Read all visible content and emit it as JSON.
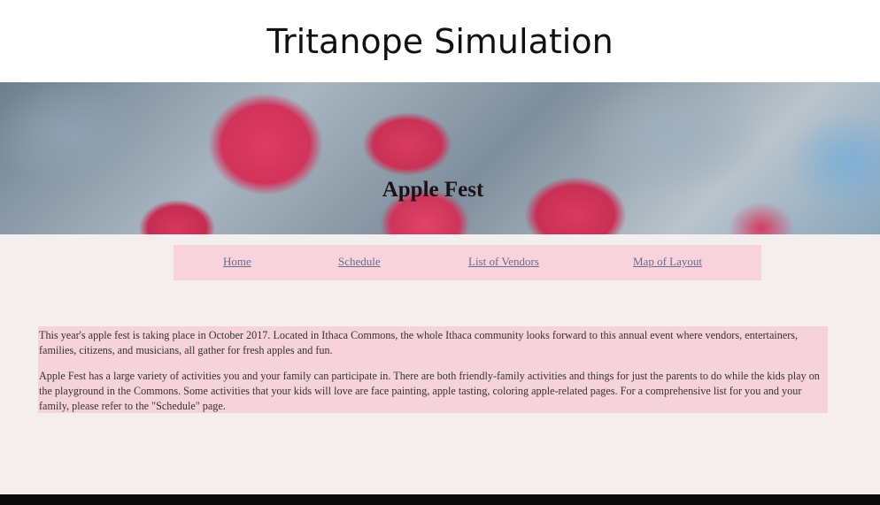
{
  "caption": "Tritanope Simulation",
  "page": {
    "title": "Apple Fest",
    "nav": [
      {
        "label": "Home"
      },
      {
        "label": "Schedule"
      },
      {
        "label": "List of Vendors"
      },
      {
        "label": "Map of Layout"
      }
    ],
    "paragraphs": [
      "This year's apple fest is taking place in October 2017. Located in Ithaca Commons, the whole Ithaca community looks forward to this annual event where vendors, entertainers, families, citizens, and musicians, all gather for fresh apples and fun.",
      "Apple Fest has a large variety of activities you and your family can participate in. There are both friendly-family activities and things for just the parents to do while the kids play on the playground in the Commons. Some activities that your kids will love are face painting, apple tasting, coloring apple-related pages. For a comprehensive list for you and your family, please refer to the \"Schedule\" page."
    ]
  },
  "colors": {
    "nav_background": "#f9d3dc",
    "content_background": "#f6d2db",
    "page_background": "#f5eeef",
    "link": "#6b6b88"
  }
}
